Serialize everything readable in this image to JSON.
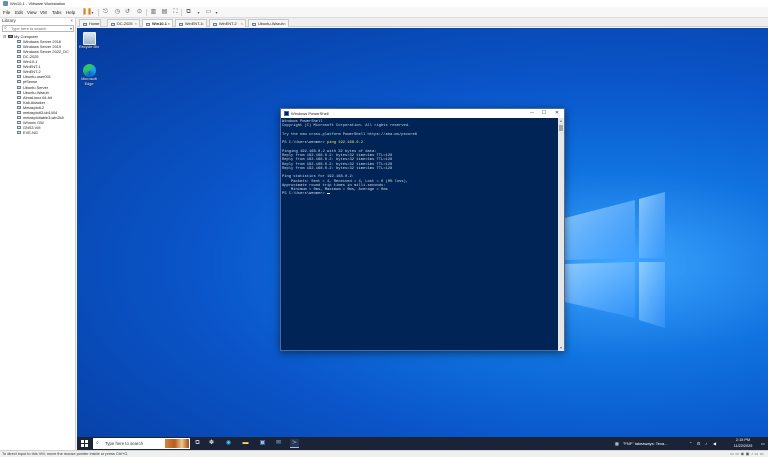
{
  "window": {
    "title": "Win10-1 - VMware Workstation"
  },
  "menu": {
    "items": [
      "File",
      "Edit",
      "View",
      "VM",
      "Tabs",
      "Help"
    ]
  },
  "library": {
    "title": "Library",
    "close": "×",
    "search_placeholder": "Type here to search",
    "root": "My Computer",
    "vms": [
      "Windows Server 2016",
      "Windows Server 2019",
      "Windows Server 2022_DC",
      "DC-2025",
      "Win10-1",
      "WinENT-1",
      "WinENT-2",
      "Ubuntu-user001",
      "pfSense",
      "Ubuntu Server",
      "Ubuntu-Wazuh",
      "AlmaLinux 64-bit",
      "Kali-Attacker",
      "Metasploit-2",
      "metasploit3-ub1404",
      "metasploitable3-win2k8",
      "Whonix GW",
      "GNS3 VM",
      "EVE-NG"
    ]
  },
  "tabs": [
    {
      "label": "Home",
      "active": false
    },
    {
      "label": "DC-2025",
      "active": false
    },
    {
      "label": "Win10-1",
      "active": true
    },
    {
      "label": "WinENT-1",
      "active": false
    },
    {
      "label": "WinENT-2",
      "active": false
    },
    {
      "label": "Ubuntu-Wazuh",
      "active": false
    }
  ],
  "desktop": {
    "icons": [
      {
        "label": "Recycle Bin"
      },
      {
        "label": "Microsoft Edge"
      }
    ]
  },
  "powershell": {
    "title": "Windows PowerShell",
    "lines": [
      "Windows PowerShell",
      "Copyright (C) Microsoft Corporation. All rights reserved.",
      "",
      "Try the new cross-platform PowerShell https://aka.ms/pscore6",
      "",
      "",
      "",
      "Pinging 192.168.0.2 with 32 bytes of data:",
      "Reply from 192.168.0.2: bytes=32 time<1ms TTL=128",
      "Reply from 192.168.0.2: bytes=32 time<1ms TTL=128",
      "Reply from 192.168.0.2: bytes=32 time<1ms TTL=128",
      "Reply from 192.168.0.2: bytes=32 time<1ms TTL=128",
      "",
      "Ping statistics for 192.168.0.2:",
      "    Packets: Sent = 4, Received = 4, Lost = 0 (0% loss),",
      "Approximate round trip times in milli-seconds:",
      "    Minimum = 0ms, Maximum = 0ms, Average = 0ms"
    ],
    "prompt_1": "PS C:\\Users\\wenmer> ",
    "command_1": "ping 192.168.0.2",
    "prompt_2": "PS C:\\Users\\wenmer> "
  },
  "taskbar": {
    "search_text": "Type here to search",
    "notification": "\"FNF\" takeaways: Texa...",
    "time": "2:15 PM",
    "date": "11/22/2025"
  },
  "status": {
    "text": "To direct input to this VM, move the mouse pointer inside or press Ctrl+G."
  },
  "colors": {
    "ps_background": "#012456",
    "desktop_blue": "#0a55c9",
    "taskbar": "#1b2436"
  }
}
